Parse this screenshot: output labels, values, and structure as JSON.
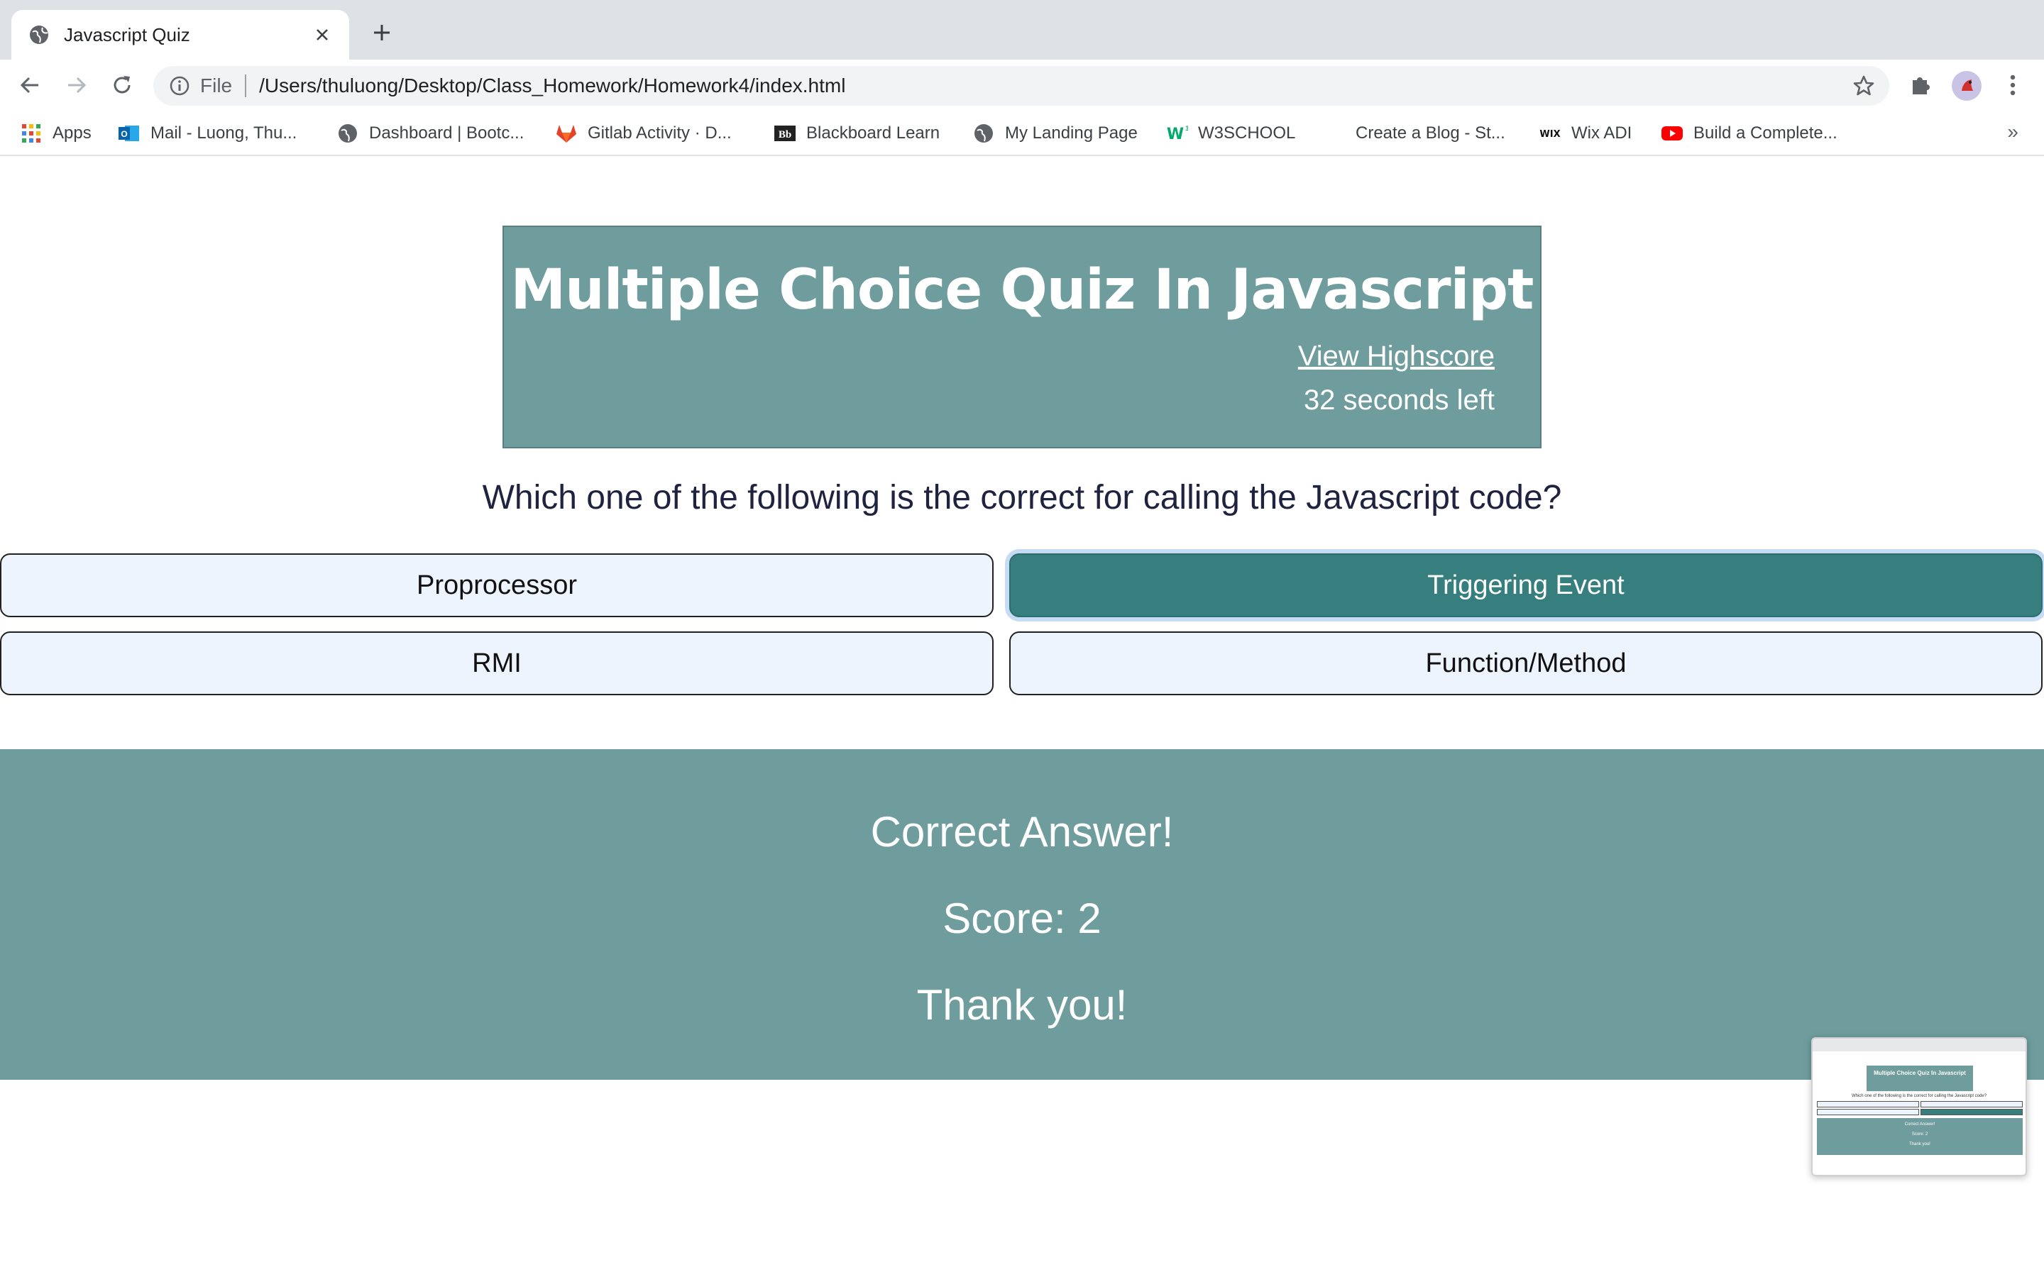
{
  "browser": {
    "tab_title": "Javascript Quiz",
    "url_scheme": "File",
    "url": "/Users/thuluong/Desktop/Class_Homework/Homework4/index.html",
    "bookmarks": [
      {
        "label": "Apps",
        "icon": "apps-grid-icon"
      },
      {
        "label": "Mail - Luong, Thu...",
        "icon": "outlook-icon"
      },
      {
        "label": "Dashboard | Bootc...",
        "icon": "globe-icon"
      },
      {
        "label": "Gitlab Activity · D...",
        "icon": "gitlab-icon"
      },
      {
        "label": "Blackboard Learn",
        "icon": "blackboard-icon"
      },
      {
        "label": "My Landing Page",
        "icon": "globe-icon"
      },
      {
        "label": "W3SCHOOL",
        "icon": "w3schools-icon"
      },
      {
        "label": "Create a Blog - St...",
        "icon": "blank-icon"
      },
      {
        "label": "Wix ADI",
        "icon": "wix-icon"
      },
      {
        "label": "Build a Complete...",
        "icon": "youtube-icon"
      }
    ],
    "more_bookmarks": "»"
  },
  "quiz": {
    "title": "Multiple Choice Quiz In Javascript",
    "highscore_link": "View Highscore",
    "timer_text": "32 seconds left",
    "question": "Which one of the following is the correct for calling the Javascript code?",
    "choices": [
      "Proprocessor",
      "Triggering Event",
      "RMI",
      "Function/Method"
    ],
    "selected_choice": "Triggering Event",
    "result": {
      "feedback": "Correct Answer!",
      "score": "Score: 2",
      "thanks": "Thank you!"
    }
  },
  "colors": {
    "header_bg": "#6f9d9d",
    "selected_choice_bg": "#377e7e",
    "choice_bg": "#eef4fd",
    "question_text": "#1f2340"
  }
}
